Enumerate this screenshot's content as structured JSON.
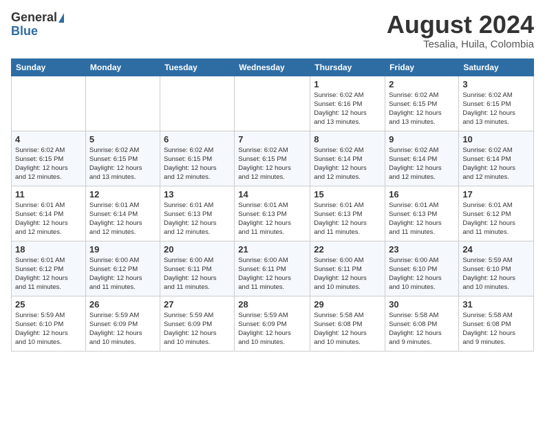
{
  "logo": {
    "general": "General",
    "blue": "Blue"
  },
  "title": {
    "month_year": "August 2024",
    "location": "Tesalia, Huila, Colombia"
  },
  "headers": [
    "Sunday",
    "Monday",
    "Tuesday",
    "Wednesday",
    "Thursday",
    "Friday",
    "Saturday"
  ],
  "weeks": [
    [
      {
        "day": "",
        "info": ""
      },
      {
        "day": "",
        "info": ""
      },
      {
        "day": "",
        "info": ""
      },
      {
        "day": "",
        "info": ""
      },
      {
        "day": "1",
        "info": "Sunrise: 6:02 AM\nSunset: 6:16 PM\nDaylight: 12 hours\nand 13 minutes."
      },
      {
        "day": "2",
        "info": "Sunrise: 6:02 AM\nSunset: 6:15 PM\nDaylight: 12 hours\nand 13 minutes."
      },
      {
        "day": "3",
        "info": "Sunrise: 6:02 AM\nSunset: 6:15 PM\nDaylight: 12 hours\nand 13 minutes."
      }
    ],
    [
      {
        "day": "4",
        "info": "Sunrise: 6:02 AM\nSunset: 6:15 PM\nDaylight: 12 hours\nand 12 minutes."
      },
      {
        "day": "5",
        "info": "Sunrise: 6:02 AM\nSunset: 6:15 PM\nDaylight: 12 hours\nand 13 minutes."
      },
      {
        "day": "6",
        "info": "Sunrise: 6:02 AM\nSunset: 6:15 PM\nDaylight: 12 hours\nand 12 minutes."
      },
      {
        "day": "7",
        "info": "Sunrise: 6:02 AM\nSunset: 6:15 PM\nDaylight: 12 hours\nand 12 minutes."
      },
      {
        "day": "8",
        "info": "Sunrise: 6:02 AM\nSunset: 6:14 PM\nDaylight: 12 hours\nand 12 minutes."
      },
      {
        "day": "9",
        "info": "Sunrise: 6:02 AM\nSunset: 6:14 PM\nDaylight: 12 hours\nand 12 minutes."
      },
      {
        "day": "10",
        "info": "Sunrise: 6:02 AM\nSunset: 6:14 PM\nDaylight: 12 hours\nand 12 minutes."
      }
    ],
    [
      {
        "day": "11",
        "info": "Sunrise: 6:01 AM\nSunset: 6:14 PM\nDaylight: 12 hours\nand 12 minutes."
      },
      {
        "day": "12",
        "info": "Sunrise: 6:01 AM\nSunset: 6:14 PM\nDaylight: 12 hours\nand 12 minutes."
      },
      {
        "day": "13",
        "info": "Sunrise: 6:01 AM\nSunset: 6:13 PM\nDaylight: 12 hours\nand 12 minutes."
      },
      {
        "day": "14",
        "info": "Sunrise: 6:01 AM\nSunset: 6:13 PM\nDaylight: 12 hours\nand 11 minutes."
      },
      {
        "day": "15",
        "info": "Sunrise: 6:01 AM\nSunset: 6:13 PM\nDaylight: 12 hours\nand 11 minutes."
      },
      {
        "day": "16",
        "info": "Sunrise: 6:01 AM\nSunset: 6:13 PM\nDaylight: 12 hours\nand 11 minutes."
      },
      {
        "day": "17",
        "info": "Sunrise: 6:01 AM\nSunset: 6:12 PM\nDaylight: 12 hours\nand 11 minutes."
      }
    ],
    [
      {
        "day": "18",
        "info": "Sunrise: 6:01 AM\nSunset: 6:12 PM\nDaylight: 12 hours\nand 11 minutes."
      },
      {
        "day": "19",
        "info": "Sunrise: 6:00 AM\nSunset: 6:12 PM\nDaylight: 12 hours\nand 11 minutes."
      },
      {
        "day": "20",
        "info": "Sunrise: 6:00 AM\nSunset: 6:11 PM\nDaylight: 12 hours\nand 11 minutes."
      },
      {
        "day": "21",
        "info": "Sunrise: 6:00 AM\nSunset: 6:11 PM\nDaylight: 12 hours\nand 11 minutes."
      },
      {
        "day": "22",
        "info": "Sunrise: 6:00 AM\nSunset: 6:11 PM\nDaylight: 12 hours\nand 10 minutes."
      },
      {
        "day": "23",
        "info": "Sunrise: 6:00 AM\nSunset: 6:10 PM\nDaylight: 12 hours\nand 10 minutes."
      },
      {
        "day": "24",
        "info": "Sunrise: 5:59 AM\nSunset: 6:10 PM\nDaylight: 12 hours\nand 10 minutes."
      }
    ],
    [
      {
        "day": "25",
        "info": "Sunrise: 5:59 AM\nSunset: 6:10 PM\nDaylight: 12 hours\nand 10 minutes."
      },
      {
        "day": "26",
        "info": "Sunrise: 5:59 AM\nSunset: 6:09 PM\nDaylight: 12 hours\nand 10 minutes."
      },
      {
        "day": "27",
        "info": "Sunrise: 5:59 AM\nSunset: 6:09 PM\nDaylight: 12 hours\nand 10 minutes."
      },
      {
        "day": "28",
        "info": "Sunrise: 5:59 AM\nSunset: 6:09 PM\nDaylight: 12 hours\nand 10 minutes."
      },
      {
        "day": "29",
        "info": "Sunrise: 5:58 AM\nSunset: 6:08 PM\nDaylight: 12 hours\nand 10 minutes."
      },
      {
        "day": "30",
        "info": "Sunrise: 5:58 AM\nSunset: 6:08 PM\nDaylight: 12 hours\nand 9 minutes."
      },
      {
        "day": "31",
        "info": "Sunrise: 5:58 AM\nSunset: 6:08 PM\nDaylight: 12 hours\nand 9 minutes."
      }
    ]
  ]
}
